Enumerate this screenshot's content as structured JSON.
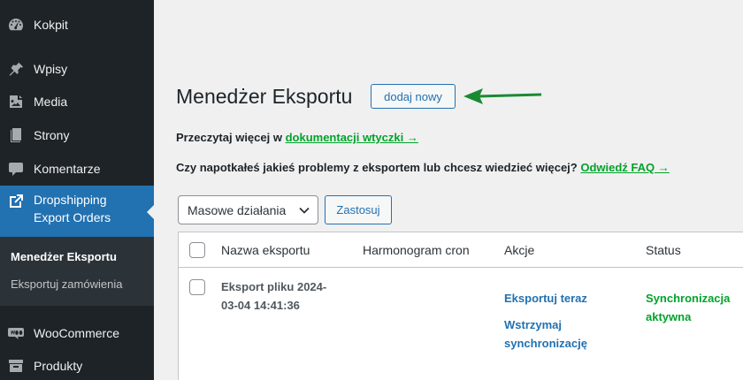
{
  "sidebar": {
    "items": [
      {
        "label": "Kokpit",
        "icon": "dashboard-icon"
      },
      {
        "label": "Wpisy",
        "icon": "pin-icon"
      },
      {
        "label": "Media",
        "icon": "media-icon"
      },
      {
        "label": "Strony",
        "icon": "pages-icon"
      },
      {
        "label": "Komentarze",
        "icon": "comment-icon"
      },
      {
        "label": "Dropshipping Export Orders",
        "label_line1": "Dropshipping",
        "label_line2": "Export Orders",
        "icon": "external-link-icon",
        "active": true
      },
      {
        "label": "WooCommerce",
        "icon": "woocommerce-icon"
      },
      {
        "label": "Produkty",
        "icon": "archive-icon"
      }
    ],
    "submenu": [
      {
        "label": "Menedżer Eksportu",
        "current": true
      },
      {
        "label": "Eksportuj zamówienia",
        "current": false
      }
    ]
  },
  "header": {
    "title": "Menedżer Eksportu",
    "add_new_label": "dodaj nowy"
  },
  "info": {
    "line1_prefix": "Przeczytaj więcej w",
    "line1_link": "dokumentacji wtyczki →",
    "line2_prefix": "Czy napotkałeś jakieś problemy z eksportem lub chcesz wiedzieć więcej?",
    "line2_link": "Odwiedź FAQ →"
  },
  "bulk": {
    "selected": "Masowe działania",
    "apply_label": "Zastosuj"
  },
  "table": {
    "columns": [
      "Nazwa eksportu",
      "Harmonogram cron",
      "Akcje",
      "Status"
    ],
    "rows": [
      {
        "name": "Eksport pliku 2024-03-04 14:41:36",
        "name_line1": "Eksport pliku 2024-",
        "name_line2": "03-04 14:41:36",
        "cron": "",
        "action_export": "Eksportuj teraz",
        "action_pause_line1": "Wstrzymaj",
        "action_pause_line2": "synchronizację",
        "status_line1": "Synchronizacja",
        "status_line2": "aktywna"
      }
    ]
  },
  "colors": {
    "sidebar_bg": "#1d2327",
    "active_bg": "#2271b1",
    "accent": "#2271b1",
    "link_green": "#00a32a"
  }
}
